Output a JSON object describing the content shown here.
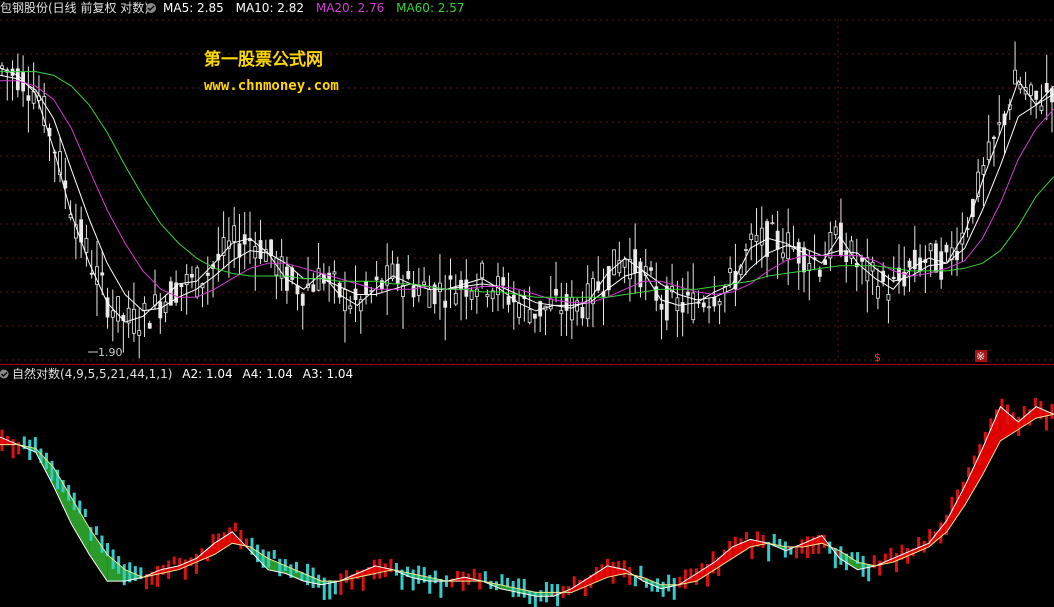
{
  "upper_legend": {
    "stock_title": "包钢股份(日线 前复权 对数)",
    "items": [
      {
        "label": "MA5: 2.85",
        "color": "#ffffff"
      },
      {
        "label": "MA10: 2.82",
        "color": "#ffffff"
      },
      {
        "label": "MA20: 2.76",
        "color": "#d23cd2"
      },
      {
        "label": "MA60: 2.57",
        "color": "#3ad23a"
      }
    ]
  },
  "lower_legend": {
    "indicator_title": "自然对数(4,9,5,5,21,44,1,1)",
    "items": [
      {
        "label": "A2: 1.04",
        "color": "#ffffff"
      },
      {
        "label": "A4: 1.04",
        "color": "#ffffff"
      },
      {
        "label": "A3: 1.04",
        "color": "#ffffff"
      }
    ]
  },
  "watermark": {
    "site_name": "第一股票公式网",
    "site_url": "www.chnmoney.com",
    "color": "#ffd700"
  },
  "low_marker": "1.90",
  "event_markers": [
    "$",
    "※"
  ],
  "colors": {
    "background": "#000000",
    "candle": "#e8e8e8",
    "ma_white": "#ffffff",
    "ma20": "#d23cd2",
    "ma60": "#3ad23a",
    "up_fill": "#e00000",
    "down_fill": "#2a9a2a",
    "cyan_bar": "#33cccc",
    "red_bar": "#e01010",
    "grid": "#8b1a1a",
    "separator": "#b00000"
  },
  "chart_data": [
    {
      "type": "line",
      "name": "price",
      "y_scale": "log",
      "ylim": [
        1.85,
        3.4
      ],
      "series": [
        {
          "name": "MA5",
          "values": [
            3.12,
            3.08,
            2.98,
            2.7,
            2.4,
            2.2,
            2.05,
            1.98,
            2.0,
            2.06,
            2.12,
            2.13,
            2.2,
            2.28,
            2.3,
            2.24,
            2.14,
            2.1,
            2.16,
            2.08,
            2.04,
            2.1,
            2.15,
            2.12,
            2.1,
            2.1,
            2.12,
            2.14,
            2.1,
            2.05,
            2.02,
            2.04,
            2.03,
            2.06,
            2.16,
            2.22,
            2.17,
            2.06,
            2.04,
            2.05,
            2.09,
            2.12,
            2.26,
            2.3,
            2.28,
            2.24,
            2.2,
            2.31,
            2.2,
            2.14,
            2.1,
            2.18,
            2.22,
            2.2,
            2.32,
            2.55,
            2.78,
            3.05,
            2.92,
            3.02
          ]
        },
        {
          "name": "MA10",
          "values": [
            3.08,
            3.06,
            3.0,
            2.85,
            2.6,
            2.38,
            2.2,
            2.08,
            2.02,
            2.03,
            2.07,
            2.1,
            2.15,
            2.21,
            2.25,
            2.24,
            2.2,
            2.14,
            2.14,
            2.11,
            2.08,
            2.08,
            2.1,
            2.12,
            2.11,
            2.1,
            2.11,
            2.12,
            2.11,
            2.08,
            2.05,
            2.04,
            2.04,
            2.05,
            2.1,
            2.15,
            2.17,
            2.12,
            2.08,
            2.06,
            2.07,
            2.1,
            2.18,
            2.24,
            2.27,
            2.26,
            2.23,
            2.25,
            2.24,
            2.18,
            2.13,
            2.15,
            2.19,
            2.2,
            2.26,
            2.42,
            2.62,
            2.86,
            2.92,
            2.98
          ]
        },
        {
          "name": "MA20",
          "values": [
            3.05,
            3.05,
            3.02,
            2.95,
            2.8,
            2.6,
            2.42,
            2.28,
            2.17,
            2.1,
            2.07,
            2.07,
            2.1,
            2.14,
            2.18,
            2.2,
            2.2,
            2.18,
            2.16,
            2.14,
            2.12,
            2.1,
            2.1,
            2.1,
            2.11,
            2.1,
            2.1,
            2.11,
            2.11,
            2.1,
            2.08,
            2.06,
            2.05,
            2.05,
            2.07,
            2.1,
            2.13,
            2.13,
            2.11,
            2.09,
            2.08,
            2.09,
            2.12,
            2.17,
            2.21,
            2.23,
            2.23,
            2.23,
            2.23,
            2.21,
            2.17,
            2.15,
            2.16,
            2.18,
            2.21,
            2.3,
            2.45,
            2.65,
            2.8,
            2.9
          ]
        },
        {
          "name": "MA60",
          "values": [
            3.1,
            3.1,
            3.1,
            3.08,
            3.02,
            2.92,
            2.78,
            2.62,
            2.48,
            2.36,
            2.28,
            2.22,
            2.18,
            2.16,
            2.15,
            2.15,
            2.15,
            2.14,
            2.14,
            2.13,
            2.13,
            2.13,
            2.12,
            2.12,
            2.11,
            2.1,
            2.1,
            2.09,
            2.09,
            2.08,
            2.07,
            2.07,
            2.07,
            2.07,
            2.07,
            2.08,
            2.09,
            2.1,
            2.1,
            2.1,
            2.11,
            2.12,
            2.13,
            2.15,
            2.16,
            2.17,
            2.18,
            2.19,
            2.19,
            2.19,
            2.18,
            2.17,
            2.17,
            2.17,
            2.18,
            2.2,
            2.25,
            2.35,
            2.48,
            2.57
          ]
        }
      ]
    },
    {
      "type": "area",
      "name": "自然对数",
      "ylim": [
        0.55,
        1.12
      ],
      "series": [
        {
          "name": "A2",
          "values": [
            0.98,
            0.96,
            0.94,
            0.85,
            0.75,
            0.67,
            0.6,
            0.6,
            0.61,
            0.63,
            0.64,
            0.66,
            0.7,
            0.73,
            0.68,
            0.63,
            0.62,
            0.6,
            0.59,
            0.6,
            0.62,
            0.64,
            0.63,
            0.61,
            0.6,
            0.6,
            0.61,
            0.6,
            0.58,
            0.57,
            0.56,
            0.56,
            0.58,
            0.61,
            0.64,
            0.63,
            0.6,
            0.58,
            0.59,
            0.62,
            0.65,
            0.69,
            0.71,
            0.7,
            0.68,
            0.7,
            0.72,
            0.66,
            0.63,
            0.64,
            0.66,
            0.68,
            0.7,
            0.76,
            0.85,
            0.95,
            1.06,
            1.02,
            1.06,
            1.04
          ]
        },
        {
          "name": "A4",
          "values": [
            0.96,
            0.96,
            0.95,
            0.9,
            0.82,
            0.74,
            0.67,
            0.63,
            0.61,
            0.62,
            0.63,
            0.65,
            0.67,
            0.7,
            0.69,
            0.66,
            0.64,
            0.62,
            0.6,
            0.6,
            0.61,
            0.62,
            0.63,
            0.62,
            0.61,
            0.6,
            0.6,
            0.6,
            0.59,
            0.58,
            0.57,
            0.57,
            0.57,
            0.59,
            0.61,
            0.62,
            0.61,
            0.59,
            0.59,
            0.6,
            0.63,
            0.66,
            0.69,
            0.7,
            0.69,
            0.69,
            0.7,
            0.68,
            0.65,
            0.64,
            0.65,
            0.67,
            0.69,
            0.73,
            0.8,
            0.88,
            0.97,
            1.0,
            1.03,
            1.04
          ]
        }
      ]
    }
  ]
}
